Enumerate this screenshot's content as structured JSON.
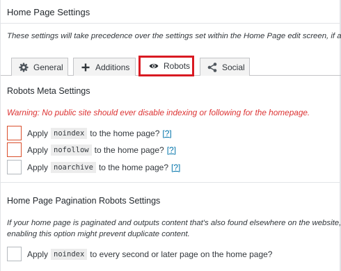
{
  "panel": {
    "title": "Home Page Settings",
    "intro": "These settings will take precedence over the settings set within the Home Page edit screen, if any."
  },
  "tabs": [
    {
      "label": "General",
      "icon": "gear-icon",
      "active": false
    },
    {
      "label": "Additions",
      "icon": "plus-icon",
      "active": false
    },
    {
      "label": "Robots",
      "icon": "eye-icon",
      "active": true
    },
    {
      "label": "Social",
      "icon": "share-icon",
      "active": false
    }
  ],
  "robots_meta": {
    "title": "Robots Meta Settings",
    "warning": "Warning: No public site should ever disable indexing or following for the homepage.",
    "options": [
      {
        "prefix": "Apply",
        "code": "noindex",
        "suffix": "to the home page?",
        "help": "[?]",
        "checked": false
      },
      {
        "prefix": "Apply",
        "code": "nofollow",
        "suffix": "to the home page?",
        "help": "[?]",
        "checked": false
      },
      {
        "prefix": "Apply",
        "code": "noarchive",
        "suffix": "to the home page?",
        "help": "[?]",
        "checked": false
      }
    ]
  },
  "pagination": {
    "title": "Home Page Pagination Robots Settings",
    "description_line1": "If your home page is paginated and outputs content that's also found elsewhere on the website,",
    "description_line2": "enabling this option might prevent duplicate content.",
    "option": {
      "prefix": "Apply",
      "code": "noindex",
      "suffix": "to every second or later page on the home page?",
      "checked": false
    }
  },
  "colors": {
    "warning": "#dc3232",
    "active_tab_highlight": "#d91a22",
    "link": "#0073aa"
  }
}
